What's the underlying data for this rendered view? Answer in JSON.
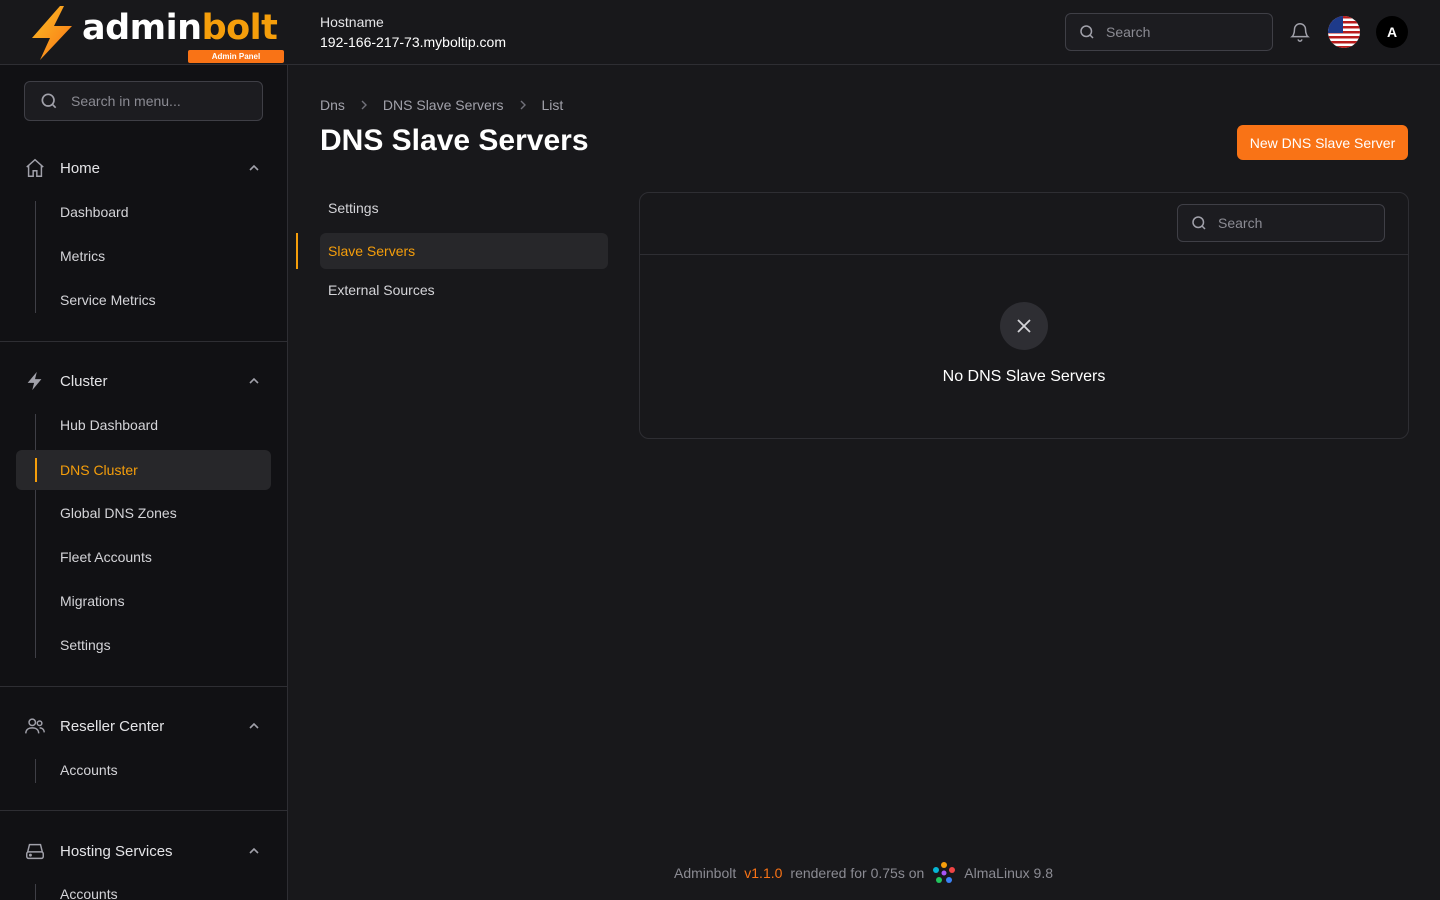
{
  "brand": {
    "name_main": "admin",
    "name_accent": "bolt",
    "tagline": "Admin Panel",
    "accent_color": "#f97316"
  },
  "header": {
    "hostname_label": "Hostname",
    "hostname_value": "192-166-217-73.myboltip.com",
    "search_placeholder": "Search",
    "avatar_initial": "A"
  },
  "sidebar": {
    "search_placeholder": "Search in menu...",
    "groups": [
      {
        "label": "Home",
        "icon": "home-icon",
        "items": [
          {
            "label": "Dashboard"
          },
          {
            "label": "Metrics"
          },
          {
            "label": "Service Metrics"
          }
        ]
      },
      {
        "label": "Cluster",
        "icon": "bolt-icon",
        "items": [
          {
            "label": "Hub Dashboard"
          },
          {
            "label": "DNS Cluster",
            "active": true
          },
          {
            "label": "Global DNS Zones"
          },
          {
            "label": "Fleet Accounts"
          },
          {
            "label": "Migrations"
          },
          {
            "label": "Settings"
          }
        ]
      },
      {
        "label": "Reseller Center",
        "icon": "users-icon",
        "items": [
          {
            "label": "Accounts"
          }
        ]
      },
      {
        "label": "Hosting Services",
        "icon": "server-icon",
        "items": [
          {
            "label": "Accounts"
          }
        ]
      }
    ]
  },
  "breadcrumb": [
    "Dns",
    "DNS Slave Servers",
    "List"
  ],
  "page": {
    "title": "DNS Slave Servers",
    "new_button": "New DNS Slave Server"
  },
  "subnav": [
    {
      "label": "Settings"
    },
    {
      "label": "Slave Servers",
      "active": true
    },
    {
      "label": "External Sources"
    }
  ],
  "table": {
    "search_placeholder": "Search",
    "empty_message": "No DNS Slave Servers"
  },
  "footer": {
    "app": "Adminbolt",
    "version": "v1.1.0",
    "rendered": "rendered for 0.75s on",
    "os": "AlmaLinux 9.8"
  }
}
